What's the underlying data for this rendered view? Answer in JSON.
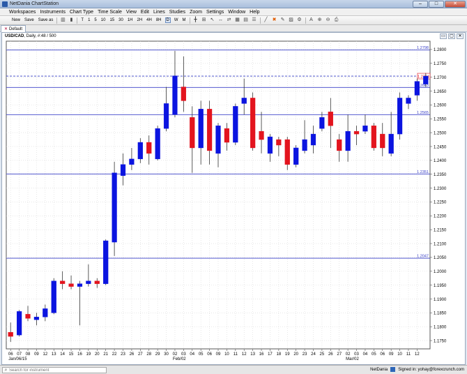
{
  "window": {
    "title": "NetDania ChartStation",
    "min": "–",
    "max": "□",
    "close": "✕"
  },
  "menu": [
    "Workspaces",
    "Instruments",
    "Chart Type",
    "Time Scale",
    "View",
    "Edit",
    "Lines",
    "Studies",
    "Zoom",
    "Settings",
    "Window",
    "Help"
  ],
  "toolbar": {
    "new": "New",
    "save": "Save",
    "save_as": "Save as",
    "periods": [
      "T",
      "1",
      "5",
      "10",
      "15",
      "30",
      "1H",
      "2H",
      "4H",
      "8H",
      "D",
      "W",
      "M"
    ],
    "selected_period": "D"
  },
  "tab": {
    "label": "Default",
    "close": "✕"
  },
  "chart_header": {
    "symbol": "USD/CAD",
    "info": ", Daily, #:48 / 500"
  },
  "statusbar": {
    "search_placeholder": "Search for instrument",
    "brand": "NetDania",
    "signed_in": "Signed in: yohay@forexcrunch.com"
  },
  "colors": {
    "up": "#0b14e0",
    "down": "#e3141e",
    "hline": "#3a40c8",
    "dashed": "#3a40c8",
    "grid": "#d8d8d8"
  },
  "chart_data": {
    "type": "candlestick",
    "y_range": [
      1.172,
      1.283
    ],
    "y_ticks": [
      1.175,
      1.18,
      1.185,
      1.19,
      1.195,
      1.2,
      1.205,
      1.21,
      1.215,
      1.22,
      1.225,
      1.23,
      1.235,
      1.24,
      1.245,
      1.25,
      1.255,
      1.26,
      1.265,
      1.27,
      1.275,
      1.28
    ],
    "y_tick_labels": [
      "1.1750",
      "1.1800",
      "1.1850",
      "1.1900",
      "1.1950",
      "1.2000",
      "1.2050",
      "1.2100",
      "1.2150",
      "1.2200",
      "1.2250",
      "1.2300",
      "1.2350",
      "1.2400",
      "1.2450",
      "1.2500",
      "1.2550",
      "1.2600",
      "1.2650",
      "1.2700",
      "1.2750",
      "1.2800"
    ],
    "x_labels": [
      "06",
      "07",
      "08",
      "09",
      "12",
      "13",
      "14",
      "15",
      "16",
      "19",
      "20",
      "21",
      "22",
      "23",
      "26",
      "27",
      "28",
      "29",
      "30",
      "02",
      "03",
      "04",
      "05",
      "06",
      "09",
      "10",
      "11",
      "12",
      "13",
      "16",
      "17",
      "18",
      "19",
      "20",
      "23",
      "24",
      "25",
      "26",
      "27",
      "02",
      "03",
      "04",
      "05",
      "06",
      "09",
      "10",
      "11",
      "12"
    ],
    "x_sub_labels": [
      {
        "index": 0,
        "text": "Jan/06/15"
      },
      {
        "index": 19,
        "text": "Feb/02"
      },
      {
        "index": 39,
        "text": "Mar/02"
      }
    ],
    "candles": [
      {
        "o": 1.178,
        "h": 1.1815,
        "l": 1.1745,
        "c": 1.1765
      },
      {
        "o": 1.177,
        "h": 1.186,
        "l": 1.1765,
        "c": 1.1855
      },
      {
        "o": 1.1845,
        "h": 1.1875,
        "l": 1.182,
        "c": 1.183
      },
      {
        "o": 1.1825,
        "h": 1.185,
        "l": 1.1805,
        "c": 1.1835
      },
      {
        "o": 1.1835,
        "h": 1.188,
        "l": 1.182,
        "c": 1.1865
      },
      {
        "o": 1.185,
        "h": 1.1975,
        "l": 1.1845,
        "c": 1.1965
      },
      {
        "o": 1.1965,
        "h": 1.2,
        "l": 1.1935,
        "c": 1.1955
      },
      {
        "o": 1.1955,
        "h": 1.1985,
        "l": 1.1935,
        "c": 1.1945
      },
      {
        "o": 1.1945,
        "h": 1.1965,
        "l": 1.1805,
        "c": 1.1955
      },
      {
        "o": 1.1955,
        "h": 1.2025,
        "l": 1.1945,
        "c": 1.1965
      },
      {
        "o": 1.1965,
        "h": 1.1975,
        "l": 1.194,
        "c": 1.1955
      },
      {
        "o": 1.1955,
        "h": 1.2115,
        "l": 1.195,
        "c": 1.211
      },
      {
        "o": 1.2105,
        "h": 1.2395,
        "l": 1.2055,
        "c": 1.2355
      },
      {
        "o": 1.2345,
        "h": 1.2425,
        "l": 1.231,
        "c": 1.2385
      },
      {
        "o": 1.2385,
        "h": 1.2445,
        "l": 1.2365,
        "c": 1.2405
      },
      {
        "o": 1.2405,
        "h": 1.248,
        "l": 1.239,
        "c": 1.2465
      },
      {
        "o": 1.2465,
        "h": 1.249,
        "l": 1.2385,
        "c": 1.2425
      },
      {
        "o": 1.2405,
        "h": 1.2525,
        "l": 1.24,
        "c": 1.2515
      },
      {
        "o": 1.2515,
        "h": 1.2665,
        "l": 1.2505,
        "c": 1.2605
      },
      {
        "o": 1.2565,
        "h": 1.2795,
        "l": 1.2555,
        "c": 1.2705
      },
      {
        "o": 1.2665,
        "h": 1.2775,
        "l": 1.2575,
        "c": 1.2615
      },
      {
        "o": 1.2555,
        "h": 1.2595,
        "l": 1.2355,
        "c": 1.2445
      },
      {
        "o": 1.2445,
        "h": 1.2615,
        "l": 1.2385,
        "c": 1.2585
      },
      {
        "o": 1.2585,
        "h": 1.2615,
        "l": 1.2385,
        "c": 1.2435
      },
      {
        "o": 1.2425,
        "h": 1.2535,
        "l": 1.2375,
        "c": 1.2525
      },
      {
        "o": 1.2515,
        "h": 1.2535,
        "l": 1.2435,
        "c": 1.2465
      },
      {
        "o": 1.2465,
        "h": 1.2605,
        "l": 1.2455,
        "c": 1.2595
      },
      {
        "o": 1.2605,
        "h": 1.2695,
        "l": 1.2565,
        "c": 1.2625
      },
      {
        "o": 1.2625,
        "h": 1.2645,
        "l": 1.2435,
        "c": 1.2445
      },
      {
        "o": 1.2505,
        "h": 1.2575,
        "l": 1.2425,
        "c": 1.2475
      },
      {
        "o": 1.2425,
        "h": 1.2495,
        "l": 1.2395,
        "c": 1.2485
      },
      {
        "o": 1.2475,
        "h": 1.2485,
        "l": 1.2415,
        "c": 1.2455
      },
      {
        "o": 1.2475,
        "h": 1.2485,
        "l": 1.2365,
        "c": 1.2385
      },
      {
        "o": 1.2385,
        "h": 1.2455,
        "l": 1.2375,
        "c": 1.2445
      },
      {
        "o": 1.2435,
        "h": 1.2545,
        "l": 1.2425,
        "c": 1.2475
      },
      {
        "o": 1.2455,
        "h": 1.2525,
        "l": 1.2425,
        "c": 1.2495
      },
      {
        "o": 1.2515,
        "h": 1.2575,
        "l": 1.2505,
        "c": 1.2555
      },
      {
        "o": 1.2575,
        "h": 1.2625,
        "l": 1.2445,
        "c": 1.2525
      },
      {
        "o": 1.2475,
        "h": 1.2495,
        "l": 1.2395,
        "c": 1.2435
      },
      {
        "o": 1.2435,
        "h": 1.2565,
        "l": 1.2395,
        "c": 1.2505
      },
      {
        "o": 1.2505,
        "h": 1.2525,
        "l": 1.2455,
        "c": 1.2495
      },
      {
        "o": 1.2505,
        "h": 1.2565,
        "l": 1.2495,
        "c": 1.2525
      },
      {
        "o": 1.2525,
        "h": 1.2535,
        "l": 1.2435,
        "c": 1.2445
      },
      {
        "o": 1.2495,
        "h": 1.2535,
        "l": 1.2415,
        "c": 1.2445
      },
      {
        "o": 1.2425,
        "h": 1.2575,
        "l": 1.2415,
        "c": 1.2495
      },
      {
        "o": 1.2495,
        "h": 1.2645,
        "l": 1.2475,
        "c": 1.2625
      },
      {
        "o": 1.2605,
        "h": 1.2635,
        "l": 1.2585,
        "c": 1.2625
      },
      {
        "o": 1.2635,
        "h": 1.2695,
        "l": 1.2615,
        "c": 1.2685
      },
      {
        "o": 1.2675,
        "h": 1.2715,
        "l": 1.2665,
        "c": 1.2704
      }
    ],
    "hlines": [
      {
        "value": 1.2798,
        "label": "1.2798"
      },
      {
        "value": 1.2663,
        "label": "1.2663"
      },
      {
        "value": 1.2565,
        "label": "1.2565"
      },
      {
        "value": 1.2351,
        "label": "1.2351"
      },
      {
        "value": 1.2047,
        "label": "1.2047"
      }
    ],
    "current_price": {
      "value": 1.2704,
      "label": "1.2704"
    },
    "grid": true
  }
}
